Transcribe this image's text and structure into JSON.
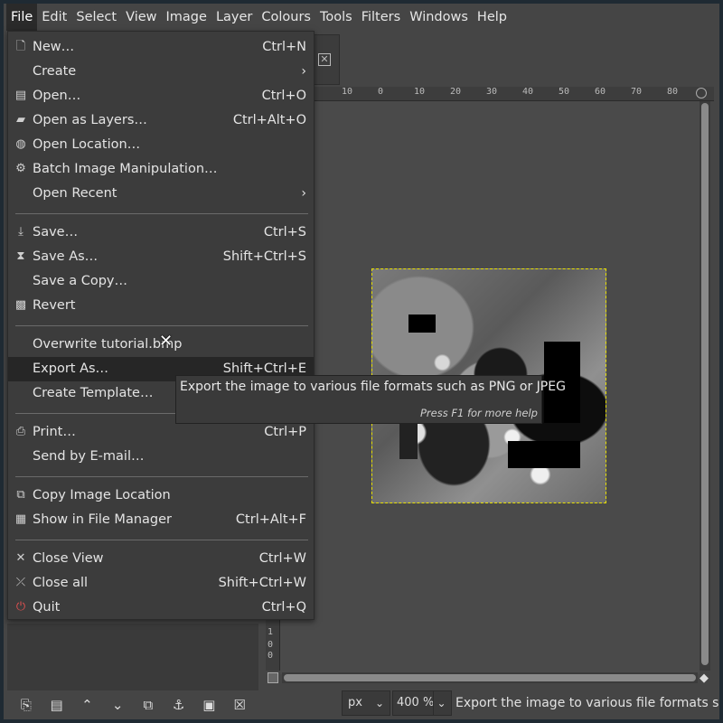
{
  "menubar": {
    "items": [
      "File",
      "Edit",
      "Select",
      "View",
      "Image",
      "Layer",
      "Colours",
      "Tools",
      "Filters",
      "Windows",
      "Help"
    ]
  },
  "file_menu": {
    "items": [
      {
        "label": "New…",
        "shortcut": "Ctrl+N",
        "icon": "new-image-icon"
      },
      {
        "label": "Create",
        "submenu": "›"
      },
      {
        "label": "Open…",
        "shortcut": "Ctrl+O",
        "icon": "open-icon"
      },
      {
        "label": "Open as Layers…",
        "shortcut": "Ctrl+Alt+O",
        "icon": "open-layers-icon"
      },
      {
        "label": "Open Location…",
        "icon": "globe-icon"
      },
      {
        "label": "Batch Image Manipulation…",
        "icon": "gears-icon"
      },
      {
        "label": "Open Recent",
        "submenu": "›"
      },
      {
        "label": "Save…",
        "shortcut": "Ctrl+S",
        "icon": "save-icon"
      },
      {
        "label": "Save As…",
        "shortcut": "Shift+Ctrl+S",
        "icon": "save-as-icon"
      },
      {
        "label": "Save a Copy…"
      },
      {
        "label": "Revert",
        "icon": "revert-icon"
      },
      {
        "label": "Overwrite tutorial.bmp"
      },
      {
        "label": "Export As…",
        "shortcut": "Shift+Ctrl+E"
      },
      {
        "label": "Create Template…"
      },
      {
        "label": "Print…",
        "shortcut": "Ctrl+P",
        "icon": "print-icon"
      },
      {
        "label": "Send by E-mail…"
      },
      {
        "label": "Copy Image Location",
        "icon": "copy-icon"
      },
      {
        "label": "Show in File Manager",
        "shortcut": "Ctrl+Alt+F",
        "icon": "file-manager-icon"
      },
      {
        "label": "Close View",
        "shortcut": "Ctrl+W",
        "icon": "close-icon"
      },
      {
        "label": "Close all",
        "shortcut": "Shift+Ctrl+W",
        "icon": "close-all-icon"
      },
      {
        "label": "Quit",
        "shortcut": "Ctrl+Q",
        "icon": "quit-icon"
      }
    ]
  },
  "tooltip": {
    "text": "Export the image to various file formats such as PNG or JPEG",
    "help": "Press F1 for more help"
  },
  "ruler": {
    "top_ticks": [
      "10",
      "0",
      "10",
      "20",
      "30",
      "40",
      "50",
      "60",
      "70",
      "80"
    ],
    "left_ticks": [
      "1",
      "0",
      "0"
    ]
  },
  "statusbar": {
    "unit": "px",
    "zoom": "400 %",
    "message": "Export the image to various file formats such as PNG or JPEG"
  },
  "colors": {
    "menu_bg": "#3c3c3c",
    "highlight": "#262626",
    "selection_border": "#e8e000"
  }
}
